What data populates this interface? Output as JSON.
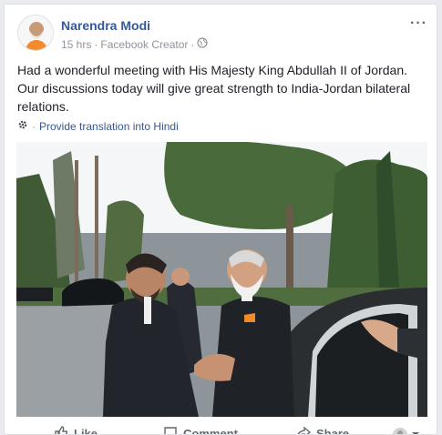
{
  "post": {
    "author": "Narendra Modi",
    "time": "15 hrs",
    "separator": "·",
    "subtitle": "Facebook Creator",
    "privacy_separator": "·",
    "more_label": "···",
    "text": "Had a wonderful meeting with His Majesty King Abdullah II of Jordan. Our discussions today will give great strength to India-Jordan bilateral relations.",
    "translate_separator": "·",
    "translate_label": "Provide translation into Hindi"
  },
  "actions": {
    "like": "Like",
    "comment": "Comment",
    "share": "Share"
  },
  "icons": {
    "privacy": "globe-icon",
    "translate": "gear-icon",
    "more": "more-options-icon",
    "like": "thumbs-up-icon",
    "comment": "comment-icon",
    "share": "share-icon"
  }
}
